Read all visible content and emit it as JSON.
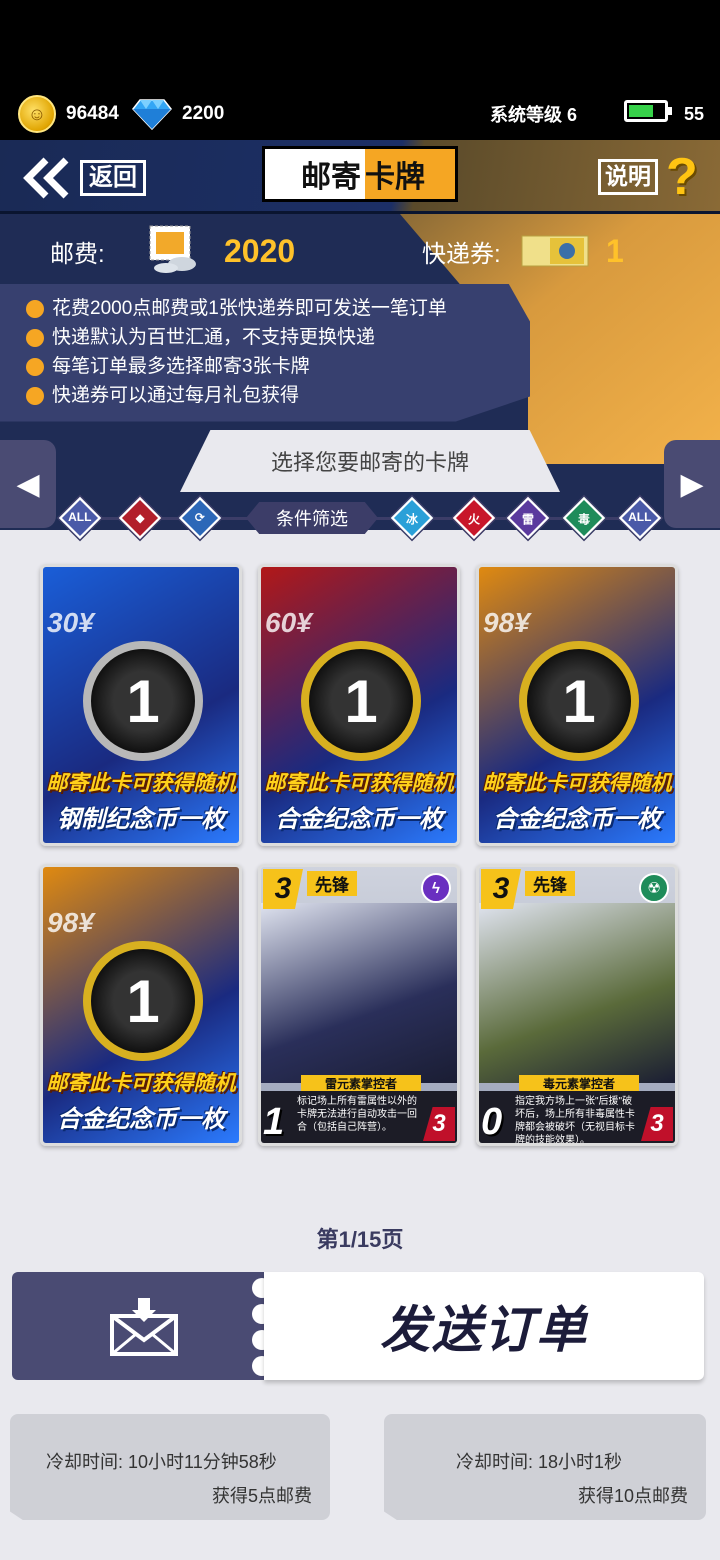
{
  "status": {
    "coins": "96484",
    "gems": "2200",
    "system_level": "系统等级 6",
    "battery": "55"
  },
  "header": {
    "back_label": "返回",
    "title_part1": "邮寄",
    "title_part2": "卡牌",
    "help_label": "说明",
    "help_mark": "?"
  },
  "fees": {
    "postage_label": "邮费:",
    "postage_value": "2020",
    "ticket_label": "快递券:",
    "ticket_value": "1"
  },
  "rules": [
    "花费2000点邮费或1张快递券即可发送一笔订单",
    "快递默认为百世汇通，不支持更换快递",
    "每笔订单最多选择邮寄3张卡牌",
    "快递券可以通过每月礼包获得"
  ],
  "select_title": "选择您要邮寄的卡牌",
  "filters": {
    "label": "条件筛选",
    "left": [
      {
        "text": "ALL",
        "color": "#4a5aa8"
      },
      {
        "text": "◆",
        "color": "#b21f2a"
      },
      {
        "text": "⟳",
        "color": "#2c68b8"
      }
    ],
    "right": [
      {
        "text": "冰",
        "color": "#2aa0d8"
      },
      {
        "text": "火",
        "color": "#c8162a"
      },
      {
        "text": "雷",
        "color": "#5b3a9e"
      },
      {
        "text": "毒",
        "color": "#1e8c5a"
      },
      {
        "text": "ALL",
        "color": "#4a5aa8"
      }
    ]
  },
  "cards": [
    {
      "kind": "coin",
      "code": "30¥",
      "cap1": "邮寄此卡可获得随机",
      "cap2": "钢制纪念币一枚",
      "bg": "#1a5ed8",
      "coin": "#b8b8b8"
    },
    {
      "kind": "coin",
      "code": "60¥",
      "cap1": "邮寄此卡可获得随机",
      "cap2": "合金纪念币一枚",
      "bg": "#b21818",
      "coin": "#d8b020"
    },
    {
      "kind": "coin",
      "code": "98¥",
      "cap1": "邮寄此卡可获得随机",
      "cap2": "合金纪念币一枚",
      "bg": "#e08a10",
      "coin": "#d8b020"
    },
    {
      "kind": "coin",
      "code": "98¥",
      "cap1": "邮寄此卡可获得随机",
      "cap2": "合金纪念币一枚",
      "bg": "#e08a10",
      "coin": "#d8b020"
    },
    {
      "kind": "char",
      "cost": "3",
      "tag": "先锋",
      "elem": "ϟ",
      "elem_color": "#6a2fc0",
      "name": "雷元素掌控者",
      "desc": "标记场上所有雷属性以外的卡牌无法进行自动攻击一回合（包括自己阵营）。",
      "atk": "1",
      "hp": "3",
      "art": "#2a2f5a"
    },
    {
      "kind": "char",
      "cost": "3",
      "tag": "先锋",
      "elem": "☢",
      "elem_color": "#1e8c5a",
      "name": "毒元素掌控者",
      "desc": "指定我方场上一张\"后援\"破坏后，场上所有非毒属性卡牌都会被破坏（无视目标卡牌的技能效果）。",
      "atk": "0",
      "hp": "3",
      "art": "#5a6a3a"
    }
  ],
  "page_info": "第1/15页",
  "send_label": "发送订单",
  "cooldowns": [
    {
      "time": "冷却时间: 10小时11分钟58秒",
      "reward": "获得5点邮费"
    },
    {
      "time": "冷却时间: 18小时1秒",
      "reward": "获得10点邮费"
    }
  ]
}
